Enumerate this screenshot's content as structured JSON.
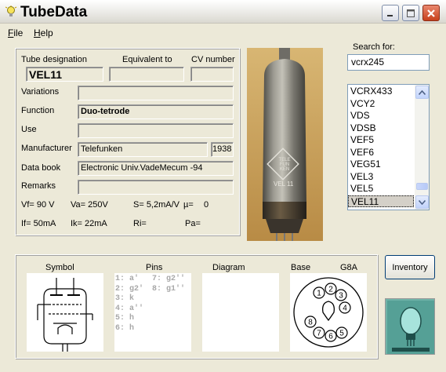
{
  "window": {
    "title": "TubeData"
  },
  "menu": [
    {
      "label": "File",
      "accel": "F",
      "rest": "ile"
    },
    {
      "label": "Help",
      "accel": "H",
      "rest": "elp"
    }
  ],
  "labels": {
    "designation": "Tube designation",
    "equivalent": "Equivalent to",
    "cv": "CV number",
    "variations": "Variations",
    "function": "Function",
    "use": "Use",
    "manufacturer": "Manufacturer",
    "databook": "Data book",
    "remarks": "Remarks"
  },
  "tube": {
    "designation": "VEL11",
    "equivalent": "",
    "cv": "",
    "variations": "",
    "function": "Duo-tetrode",
    "use": "",
    "manufacturer": "Telefunken",
    "year": "1938",
    "databook": "Electronic Univ.VadeMecum -94",
    "remarks": ""
  },
  "params": {
    "vf": "Vf= 90 V",
    "va": "Va= 250V",
    "s": "S= 5,2mA/V",
    "mu": "µ=",
    "mu_val": "0",
    "if": "If= 50mA",
    "ik": "Ik= 22mA",
    "ri": "Ri=",
    "pa": "Pa="
  },
  "photo": {
    "glass_label": "VEL 11",
    "logo_letters": "TELE FUN KEN"
  },
  "search": {
    "label": "Search for:",
    "value": "vcrx245",
    "results": [
      "VCRX433",
      "VCY2",
      "VDS",
      "VDSB",
      "VEF5",
      "VEF6",
      "VEG51",
      "VEL3",
      "VEL5",
      "VEL11"
    ],
    "selected_index": 9
  },
  "bottom": {
    "symbol": "Symbol",
    "pins_header": "Pins",
    "diagram": "Diagram",
    "base": "Base",
    "base_type": "G8A",
    "pins_left": [
      "1: a'",
      "2: g2'",
      "3: k",
      "4: a''",
      "5: h",
      "6: h"
    ],
    "pins_right": [
      "7: g2''",
      "8: g1''"
    ],
    "base_numbers": [
      "1",
      "2",
      "3",
      "4",
      "5",
      "6",
      "7",
      "8"
    ]
  },
  "buttons": {
    "inventory": "Inventory"
  },
  "colors": {
    "close": "#C7411C",
    "selection": "#D4D0C8",
    "pins_text": "#A8A8A8"
  }
}
